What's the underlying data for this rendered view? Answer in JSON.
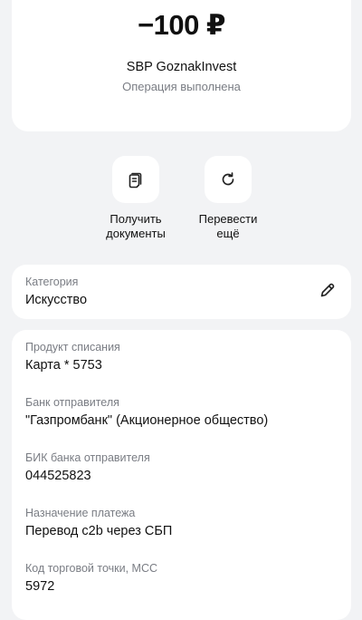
{
  "summary": {
    "amount": "−100 ₽",
    "merchant": "SBP GoznakInvest",
    "status": "Операция выполнена"
  },
  "actions": [
    {
      "label": "Получить\nдокументы",
      "icon": "document-icon"
    },
    {
      "label": "Перевести\nещё",
      "icon": "repeat-icon"
    }
  ],
  "category": {
    "label": "Категория",
    "value": "Искусство",
    "edit_icon": "pencil-icon"
  },
  "details": [
    {
      "label": "Продукт списания",
      "value": "Карта * 5753"
    },
    {
      "label": "Банк отправителя",
      "value": "\"Газпромбанк\" (Акционерное общество)"
    },
    {
      "label": "БИК банка отправителя",
      "value": "044525823"
    },
    {
      "label": "Назначение платежа",
      "value": "Перевод c2b через СБП"
    },
    {
      "label": "Код торговой точки, МСС",
      "value": "5972"
    }
  ]
}
